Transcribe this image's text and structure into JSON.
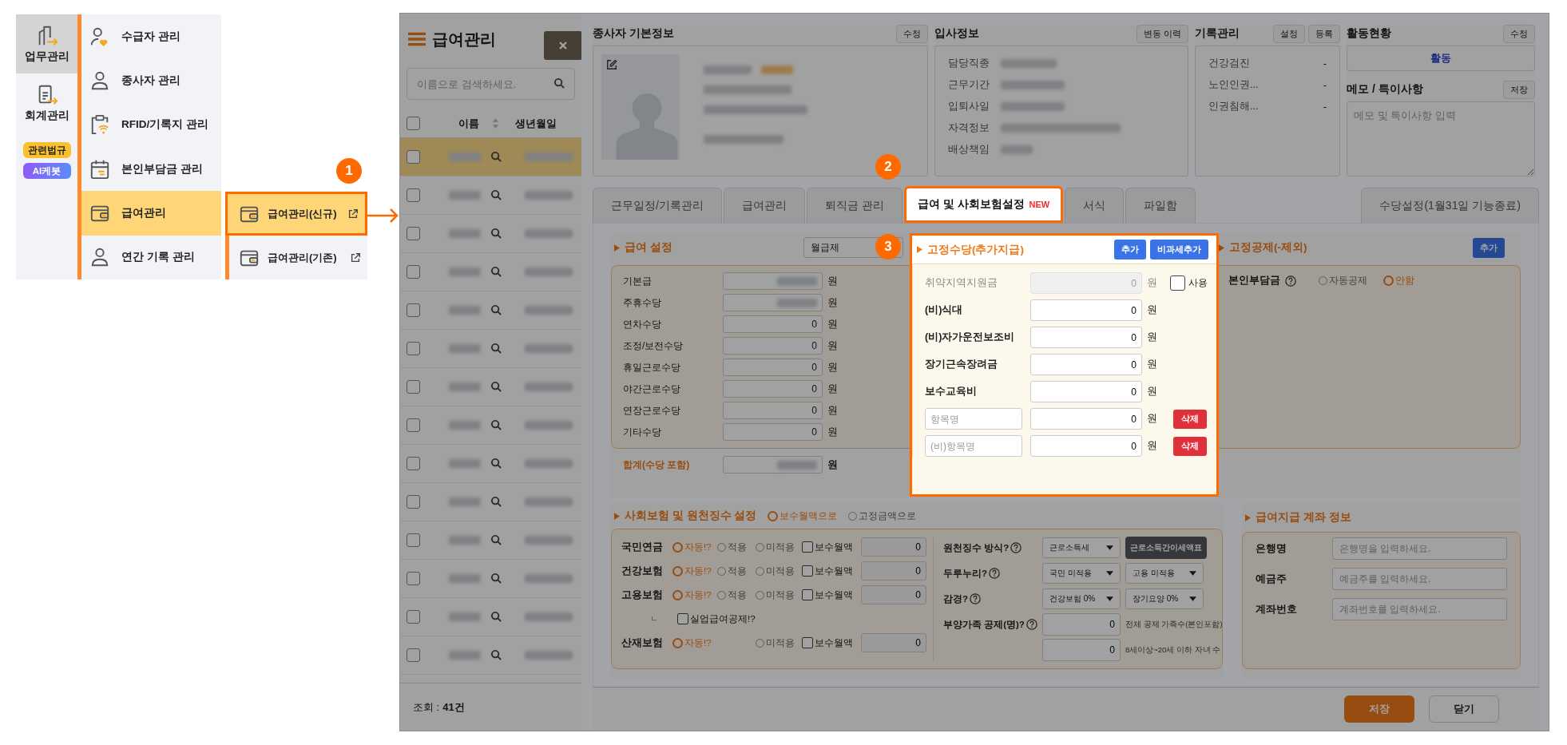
{
  "nav": {
    "categories": [
      {
        "label": "업무관리",
        "selected": true
      },
      {
        "label": "회계관리",
        "selected": false
      }
    ],
    "badges": [
      {
        "label": "관련법규",
        "kind": "law"
      },
      {
        "label": "AI케봇",
        "kind": "ai"
      }
    ],
    "menu": [
      {
        "label": "수급자 관리",
        "selected": false
      },
      {
        "label": "종사자 관리",
        "selected": false
      },
      {
        "label": "RFID/기록지 관리",
        "selected": false
      },
      {
        "label": "본인부담금 관리",
        "selected": false
      },
      {
        "label": "급여관리",
        "selected": true
      },
      {
        "label": "연간 기록 관리",
        "selected": false
      }
    ],
    "submenu": [
      {
        "label": "급여관리(신규)",
        "selected": true
      },
      {
        "label": "급여관리(기존)",
        "selected": false
      }
    ]
  },
  "callouts": [
    "1",
    "2",
    "3"
  ],
  "list": {
    "title": "급여관리",
    "search": {
      "placeholder": "이름으로 검색하세요."
    },
    "columns": [
      "이름",
      "생년월일"
    ],
    "all_checked": false,
    "rows": [
      {
        "selected": true,
        "checked": false
      },
      {
        "selected": false,
        "checked": false
      },
      {
        "selected": false,
        "checked": false
      },
      {
        "selected": false,
        "checked": false
      },
      {
        "selected": false,
        "checked": false
      },
      {
        "selected": false,
        "checked": false
      },
      {
        "selected": false,
        "checked": false
      },
      {
        "selected": false,
        "checked": false
      },
      {
        "selected": false,
        "checked": false
      },
      {
        "selected": false,
        "checked": false
      },
      {
        "selected": false,
        "checked": false
      },
      {
        "selected": false,
        "checked": false
      },
      {
        "selected": false,
        "checked": false
      },
      {
        "selected": false,
        "checked": false
      }
    ],
    "footer": {
      "label": "조회 :",
      "count": "41건"
    }
  },
  "employee": {
    "title": "종사자 기본정보",
    "button": "수정"
  },
  "hire": {
    "title": "입사정보",
    "button": "변동 이력",
    "labels": [
      "담당직종",
      "근무기간",
      "입퇴사일",
      "자격정보",
      "배상책임"
    ]
  },
  "records": {
    "title": "기록관리",
    "buttons": [
      "설정",
      "등록"
    ],
    "items": [
      {
        "label": "건강검진",
        "value": "-"
      },
      {
        "label": "노인인권...",
        "value": "-"
      },
      {
        "label": "인권침해...",
        "value": "-"
      }
    ]
  },
  "activity": {
    "title": "활동현황",
    "button": "수정",
    "status": "활동"
  },
  "memo": {
    "title": "메모 / 특이사항",
    "button": "저장",
    "placeholder": "메모 및 특이사항 입력"
  },
  "tabs": [
    {
      "label": "근무일정/기록관리",
      "selected": false
    },
    {
      "label": "급여관리",
      "selected": false
    },
    {
      "label": "퇴직금 관리",
      "selected": false
    },
    {
      "label": "급여 및 사회보험설정",
      "badge": "NEW",
      "selected": true
    },
    {
      "label": "서식",
      "selected": false
    },
    {
      "label": "파일함",
      "selected": false
    }
  ],
  "side_tab": "수당설정(1월31일 기능종료)",
  "pay": {
    "title": "급여 설정",
    "pay_type": "월급제",
    "rows": [
      {
        "label": "기본급",
        "blurred": true,
        "unit": "원"
      },
      {
        "label": "주휴수당",
        "blurred": true,
        "unit": "원"
      },
      {
        "label": "연차수당",
        "value": "0",
        "unit": "원"
      },
      {
        "label": "조정/보전수당",
        "value": "0",
        "unit": "원"
      },
      {
        "label": "휴일근로수당",
        "value": "0",
        "unit": "원"
      },
      {
        "label": "야간근로수당",
        "value": "0",
        "unit": "원"
      },
      {
        "label": "연장근로수당",
        "value": "0",
        "unit": "원"
      },
      {
        "label": "기타수당",
        "value": "0",
        "unit": "원"
      }
    ],
    "total": {
      "label": "합계(수당 포함)",
      "blurred": true,
      "unit": "원"
    }
  },
  "fixed_allowance": {
    "title": "고정수당(추가지급)",
    "buttons": [
      {
        "label": "추가"
      },
      {
        "label": "비과세추가"
      }
    ],
    "rows": [
      {
        "kind": "locked",
        "label": "취약지역지원금",
        "value": "0",
        "unit": "원",
        "checkbox": {
          "label": "사용",
          "checked": false
        }
      },
      {
        "kind": "item",
        "label": "(비)식대",
        "value": "0",
        "unit": "원"
      },
      {
        "kind": "item",
        "label": "(비)자가운전보조비",
        "value": "0",
        "unit": "원"
      },
      {
        "kind": "item",
        "label": "장기근속장려금",
        "value": "0",
        "unit": "원"
      },
      {
        "kind": "item",
        "label": "보수교육비",
        "value": "0",
        "unit": "원"
      },
      {
        "kind": "custom",
        "placeholder": "항목명",
        "value": "0",
        "unit": "원",
        "button": "삭제"
      },
      {
        "kind": "custom",
        "placeholder": "(비)항목명",
        "value": "0",
        "unit": "원",
        "button": "삭제"
      }
    ]
  },
  "deduction": {
    "title": "고정공제(-제외)",
    "button": "추가",
    "label": "본인부담금",
    "options": [
      {
        "label": "자동공제",
        "selected": false
      },
      {
        "label": "안함",
        "selected": true
      }
    ]
  },
  "insurance": {
    "title": "사회보험 및 원천징수 설정",
    "modes": [
      {
        "label": "보수월액으로",
        "selected": true
      },
      {
        "label": "고정금액으로",
        "selected": false
      }
    ],
    "rows": [
      {
        "kind": "insurance",
        "label": "국민연금",
        "options": [
          {
            "label": "자동!?",
            "selected": true
          },
          {
            "label": "적용",
            "selected": false
          },
          {
            "label": "미적용",
            "selected": false
          }
        ],
        "checkbox": {
          "label": "보수월액",
          "checked": false
        },
        "value": "0"
      },
      {
        "kind": "insurance",
        "label": "건강보험",
        "options": [
          {
            "label": "자동!?",
            "selected": true
          },
          {
            "label": "적용",
            "selected": false
          },
          {
            "label": "미적용",
            "selected": false
          }
        ],
        "checkbox": {
          "label": "보수월액",
          "checked": false
        },
        "value": "0"
      },
      {
        "kind": "insurance",
        "label": "고용보험",
        "options": [
          {
            "label": "자동!?",
            "selected": true
          },
          {
            "label": "적용",
            "selected": false
          },
          {
            "label": "미적용",
            "selected": false
          }
        ],
        "checkbox": {
          "label": "보수월액",
          "checked": false
        },
        "value": "0"
      },
      {
        "kind": "sub",
        "marker": "ㄴ",
        "checkbox": {
          "label": "실업급여공제!?",
          "checked": false
        }
      },
      {
        "kind": "insurance",
        "label": "산재보험",
        "options": [
          {
            "label": "자동!?",
            "selected": true
          },
          {
            "label": "미적용",
            "selected": false
          }
        ],
        "checkbox": {
          "label": "보수월액",
          "checked": false
        },
        "value": "0"
      }
    ],
    "withholding": [
      {
        "kind": "select",
        "label": "원천징수 방식?",
        "selects": [
          "근로소득세"
        ],
        "button": "근로소득간이세액표"
      },
      {
        "kind": "select",
        "label": "두루누리?",
        "selects": [
          "국민 미적용",
          "고용 미적용"
        ]
      },
      {
        "kind": "select",
        "label": "감경?",
        "selects": [
          "건강보험 0%",
          "장기요양 0%"
        ]
      },
      {
        "kind": "number",
        "label": "부양가족 공제(명)?",
        "value": "0",
        "note": "전체 공제 가족수(본인포함)"
      },
      {
        "kind": "number",
        "value": "0",
        "note": "8세이상~20세 이하 자녀 수"
      }
    ]
  },
  "bank": {
    "title": "급여지급 계좌 정보",
    "fields": [
      {
        "label": "은행명",
        "placeholder": "은행명을 입력하세요."
      },
      {
        "label": "예금주",
        "placeholder": "예금주를 입력하세요."
      },
      {
        "label": "계좌번호",
        "placeholder": "계좌번호를 입력하세요."
      }
    ]
  },
  "actions": [
    {
      "label": "저장",
      "kind": "primary"
    },
    {
      "label": "닫기",
      "kind": "secondary"
    }
  ]
}
